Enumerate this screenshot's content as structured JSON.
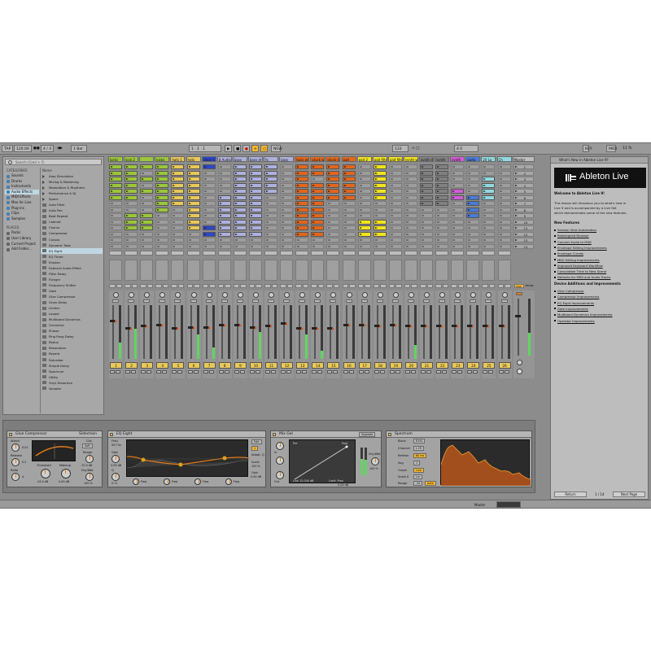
{
  "control_bar": {
    "tap": "TAP",
    "tempo": "120.00",
    "signature": "4 / 4",
    "quantize": "1 Bar",
    "arrangement_pos": "1 . 1 . 1",
    "new": "NEW",
    "loop_len": "133",
    "key": "KEY",
    "midi": "MIDI",
    "cpu": "11 %"
  },
  "browser": {
    "search_placeholder": "Search (Cmd + F)",
    "categories_header": "CATEGORIES",
    "categories": [
      "Sounds",
      "Drums",
      "Instruments",
      "Audio Effects",
      "MIDI Effects",
      "Max for Live",
      "Plug-ins",
      "Clips",
      "Samples"
    ],
    "selected_category": "Audio Effects",
    "places_header": "PLACES",
    "places": [
      "Packs",
      "User Library",
      "Current Project",
      "Add Folder..."
    ],
    "list_header": "Name",
    "items": [
      "Amp Simulation",
      "Mixing & Mastering",
      "Modulation & Rhythmic",
      "Performance & DJ",
      "Space",
      "Auto Filter",
      "Auto Pan",
      "Beat Repeat",
      "Cabinet",
      "Chorus",
      "Compressor",
      "Corpus",
      "Dynamic Tube",
      "EQ Eight",
      "EQ Three",
      "Erosion",
      "External Audio Effect",
      "Filter Delay",
      "Flanger",
      "Frequency Shifter",
      "Gate",
      "Glue Compressor",
      "Grain Delay",
      "Limiter",
      "Looper",
      "Multiband Dynamics",
      "Overdrive",
      "Phaser",
      "Ping Pong Delay",
      "Redux",
      "Resonators",
      "Reverb",
      "Saturator",
      "Simple Delay",
      "Spectrum",
      "Utility",
      "Vinyl Distortion",
      "Vocoder"
    ],
    "selected_item": "EQ Eight"
  },
  "tracks": [
    {
      "name": "kicks",
      "color": "#9bc63a",
      "num": "1",
      "numColor": "#e8c85a",
      "clips": [
        0,
        1,
        2,
        3,
        4,
        5
      ],
      "meter": 0.3,
      "fader": 0.7
    },
    {
      "name": "kick 2",
      "color": "#9bc63a",
      "num": "2",
      "numColor": "#e8c85a",
      "clips": [
        0,
        1,
        2,
        3,
        4,
        5,
        8,
        9,
        10
      ],
      "meter": 0.55,
      "fader": 0.55
    },
    {
      "name": "",
      "color": "#9bc63a",
      "num": "3",
      "numColor": "#e8c85a",
      "clips": [
        0,
        2,
        4,
        8,
        9,
        10
      ],
      "meter": 0.0,
      "fader": 0.6
    },
    {
      "name": "kicks",
      "color": "#9bc63a",
      "num": "4",
      "numColor": "#e8c85a",
      "clips": [
        0,
        1,
        2,
        3,
        4,
        5,
        6,
        7
      ],
      "meter": 0.0,
      "fader": 0.62
    },
    {
      "name": "hats 1",
      "color": "#e8c85a",
      "num": "5",
      "numColor": "#e8c85a",
      "clips": [
        0,
        1,
        2,
        3,
        4,
        5,
        6
      ],
      "meter": 0.0,
      "fader": 0.55
    },
    {
      "name": "hats",
      "color": "#e8c85a",
      "num": "6",
      "numColor": "#e8c85a",
      "clips": [
        0,
        1,
        2,
        3,
        4,
        5,
        6,
        7,
        8,
        9,
        10
      ],
      "meter": 0.45,
      "fader": 0.58
    },
    {
      "name": "claps 1",
      "color": "#2c47c9",
      "num": "7",
      "numColor": "#e8c85a",
      "clips": [
        0,
        10,
        11
      ],
      "meter": 0.2,
      "fader": 0.58
    },
    {
      "name": "8 Audio",
      "color": "#aeb0dc",
      "num": "8",
      "numColor": "#e8c85a",
      "clips": [
        5,
        6,
        7,
        8,
        9,
        10,
        11
      ],
      "meter": 0.0,
      "fader": 0.62
    },
    {
      "name": "bass",
      "color": "#aeb0dc",
      "num": "9",
      "numColor": "#e8c85a",
      "clips": [
        0,
        1,
        2,
        3,
        4,
        5,
        6,
        7,
        8,
        9,
        10,
        11
      ],
      "meter": 0.0,
      "fader": 0.62
    },
    {
      "name": "bass dry",
      "color": "#aeb0dc",
      "num": "10",
      "numColor": "#e8c85a",
      "clips": [
        0,
        1,
        2,
        3,
        4,
        5,
        6,
        7,
        8,
        9,
        10,
        11
      ],
      "meter": 0.5,
      "fader": 0.58
    },
    {
      "name": "fx",
      "color": "#aeb0dc",
      "num": "11",
      "numColor": "#e8c85a",
      "clips": [
        0,
        1,
        2,
        3,
        4
      ],
      "meter": 0.0,
      "fader": 0.6
    },
    {
      "name": "bass",
      "color": "#aeb0dc",
      "num": "12",
      "numColor": "#e8c85a",
      "clips": [],
      "meter": 0.0,
      "fader": 0.65
    },
    {
      "name": "bass wet",
      "color": "#e2661c",
      "num": "13",
      "numColor": "#e8c85a",
      "clips": [
        0,
        1,
        2,
        3,
        4,
        5,
        6,
        7,
        8,
        9,
        10,
        11
      ],
      "meter": 0.45,
      "fader": 0.55
    },
    {
      "name": "pluck wo",
      "color": "#e2661c",
      "num": "14",
      "numColor": "#e8c85a",
      "clips": [
        0,
        1,
        3,
        4,
        5,
        6,
        7,
        8,
        9,
        10,
        11
      ],
      "meter": 0.15,
      "fader": 0.55
    },
    {
      "name": "pluck dry",
      "color": "#e2661c",
      "num": "15",
      "numColor": "#e8c85a",
      "clips": [
        0,
        1,
        2,
        3,
        4,
        5
      ],
      "meter": 0.0,
      "fader": 0.55
    },
    {
      "name": "pad",
      "color": "#e2661c",
      "num": "16",
      "numColor": "#e8c85a",
      "clips": [
        0,
        1,
        2,
        3,
        4,
        5
      ],
      "meter": 0.0,
      "fader": 0.62
    },
    {
      "name": "pad 2",
      "color": "#f2e31d",
      "num": "17",
      "numColor": "#e8c85a",
      "clips": [
        9,
        10,
        11
      ],
      "meter": 0.0,
      "fader": 0.62
    },
    {
      "name": "pad filter",
      "color": "#f2e31d",
      "num": "18",
      "numColor": "#e8c85a",
      "clips": [
        0,
        1,
        2,
        3,
        4,
        5,
        9,
        10,
        11
      ],
      "meter": 0.0,
      "fader": 0.6
    },
    {
      "name": "pad filter",
      "color": "#f2e31d",
      "num": "19",
      "numColor": "#e8c85a",
      "clips": [],
      "meter": 0.0,
      "fader": 0.62
    },
    {
      "name": "synth wo",
      "color": "#f2e31d",
      "num": "20",
      "numColor": "#e8c85a",
      "clips": [],
      "meter": 0.25,
      "fader": 0.6
    },
    {
      "name": "synth dry",
      "color": "#808080",
      "num": "21",
      "numColor": "#e8c85a",
      "clips": [
        0,
        1,
        2,
        3,
        4,
        5,
        6
      ],
      "meter": 0.0,
      "fader": 0.6
    },
    {
      "name": "synth",
      "color": "#808080",
      "num": "22",
      "numColor": "#e8c85a",
      "clips": [
        0,
        1,
        2,
        3,
        4,
        5,
        6
      ],
      "meter": 0.0,
      "fader": 0.6
    },
    {
      "name": "synth",
      "color": "#d35ad6",
      "num": "23",
      "numColor": "#e8c85a",
      "clips": [
        4,
        5
      ],
      "meter": 0.0,
      "fader": 0.6
    },
    {
      "name": "guita",
      "color": "#4a7bd6",
      "num": "24",
      "numColor": "#e8c85a",
      "clips": [
        5,
        6,
        7,
        8
      ],
      "meter": 0.0,
      "fader": 0.6
    },
    {
      "name": "20 Lo",
      "color": "#93d8e0",
      "num": "25",
      "numColor": "#e8c85a",
      "clips": [
        2,
        3,
        4,
        5
      ],
      "meter": 0.0,
      "fader": 0.6
    },
    {
      "name": "Ch",
      "color": "#93d8e0",
      "num": "26",
      "numColor": "#e8c85a",
      "clips": [],
      "meter": 0.0,
      "fader": 0.6
    }
  ],
  "master": {
    "name": "Master",
    "scenes": [
      "1",
      "2",
      "3",
      "4",
      "5",
      "6",
      "7",
      "8",
      "9",
      "10",
      "11",
      "12",
      "13",
      "14"
    ],
    "sends": "Sends",
    "post": "Post"
  },
  "devices": {
    "glue": {
      "title": "Glue Compressor",
      "mode": "Sidechain",
      "attack": "Attack",
      "release": "Release",
      "ratio": "Ratio",
      "threshold": "Threshold",
      "makeup": "Makeup",
      "threshold_val": "-15.0 dB",
      "makeup_val": "0.00 dB",
      "range": "Range",
      "range_val": "-70.0 dB",
      "drywet": "Dry/Wet",
      "drywet_val": "100 %",
      "clip": "Clip",
      "soft": "Soft",
      "attack_val": "0.01",
      "release_val": "0.2",
      "ratio_val": "4"
    },
    "eq": {
      "title": "EQ Eight",
      "freq": "Freq",
      "freq_val": "927 Hz",
      "gain": "Gain",
      "gain_val": "4.93 dB",
      "q": "Q",
      "q_val": "0.71",
      "adapt": "Adapt. Q",
      "scale": "Scale",
      "scale_val": "100 %",
      "gain_out": "Gain",
      "gain_out_val": "0.00 dB",
      "edit": "Edit",
      "band": "1",
      "freq_row": [
        "Freq",
        "Freq",
        "Freq",
        "Freq"
      ]
    },
    "mixgel": {
      "title": "Mix Gel",
      "upgrade": "Upgrade",
      "pre": "Pre",
      "post": "Post",
      "links": "Link 12.000 dB",
      "lim": "Limit: Prox",
      "drywet": "Dry/Wet",
      "drywet_val": "100 %",
      "out_val": "0.00 dB",
      "in": "In",
      "out": "Out"
    },
    "spectrum": {
      "title": "Spectrum",
      "block": "Block",
      "block_val": "8192",
      "channel": "Channel",
      "channel_val": "L+R",
      "refresh": "Refresh",
      "refresh_val": "60 ms",
      "avg": "Avg",
      "avg_val": "1",
      "graph": "Graph",
      "graph_val": "Line",
      "scalex": "Scale X",
      "scalex_val": "Lin",
      "range": "Range",
      "range_val": "-24",
      "auto": "Auto"
    }
  },
  "help": {
    "title": "What's New in Ableton Live 9?",
    "logo": "Ableton Live",
    "welcome": "Welcome to Ableton Live 9!",
    "intro": [
      "This lesson will introduce you to what's new in",
      "Live 9 and is accompanied by a Live Set",
      "which demonstrates some of the new features."
    ],
    "new_features": "New Features",
    "features": [
      "Session View Automation",
      "Redesigned Browser",
      "Convert Audio to MIDI",
      "Envelope Editing Improvements",
      "Envelope Curves",
      "MIDI Editing Improvements",
      "Improved Keyboard Workflow",
      "Consolidate Time to New Scene",
      "Defaults for MIDI and Audio Tracks"
    ],
    "device_header": "Device Additions and Improvements",
    "devices": [
      "Glue Compressor",
      "Compressor Improvements",
      "EQ Eight Improvements",
      "Gate Improvements",
      "Multiband Dynamics Improvements",
      "Operator Improvements"
    ],
    "return": "Return",
    "page": "1 / 14",
    "next": "Next Page"
  },
  "status": {
    "label": "Master"
  }
}
